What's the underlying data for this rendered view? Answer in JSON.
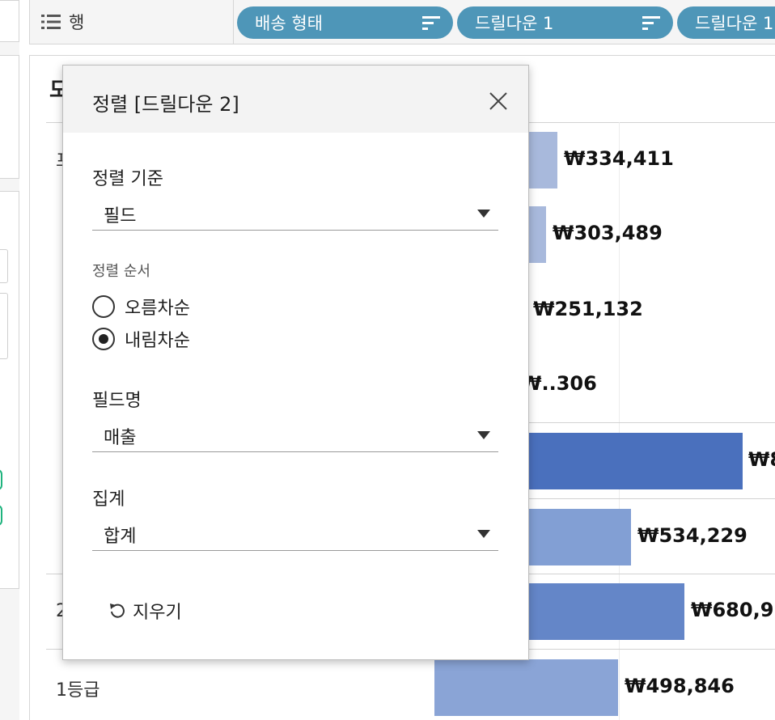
{
  "shelf": {
    "label": "행",
    "pills": [
      {
        "label": "배송 형태"
      },
      {
        "label": "드릴다운 1"
      },
      {
        "label": "드릴다운 1"
      }
    ]
  },
  "view": {
    "title": "도",
    "row_labels": [
      "프",
      "2",
      "1등급"
    ],
    "bar_labels": [
      "₩334,411",
      "₩303,489",
      "₩251,132",
      "₩..306",
      "₩8",
      "₩534,229",
      "₩680,9",
      "₩498,846"
    ]
  },
  "chart_data": {
    "type": "bar",
    "orientation": "horizontal",
    "values": [
      334411,
      303489,
      251132,
      null,
      null,
      534229,
      null,
      498846
    ],
    "value_labels": [
      "₩334,411",
      "₩303,489",
      "₩251,132",
      "₩..306",
      "₩8",
      "₩534,229",
      "₩680,9",
      "₩498,846"
    ],
    "colors": [
      "#a8b9dc",
      "#a8b9dc",
      "#a8b9dc",
      "#a8b9dc",
      "#4a70bd",
      "#829fd4",
      "#6486c8",
      "#8aa4d6"
    ]
  },
  "dialog": {
    "title": "정렬 [드릴다운 2]",
    "sort_by": {
      "label": "정렬 기준",
      "value": "필드"
    },
    "sort_order": {
      "label": "정렬 순서",
      "options": [
        {
          "label": "오름차순",
          "checked": false
        },
        {
          "label": "내림차순",
          "checked": true
        }
      ]
    },
    "field_name": {
      "label": "필드명",
      "value": "매출"
    },
    "aggregation": {
      "label": "집계",
      "value": "합계"
    },
    "clear_label": "지우기"
  }
}
